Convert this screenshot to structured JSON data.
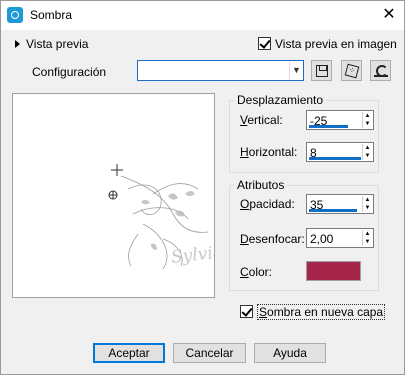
{
  "window": {
    "title": "Sombra",
    "app_icon": "paintshop-icon",
    "close_icon": "close-icon"
  },
  "preview": {
    "toggle_label": "Vista previa",
    "in_image_label": "Vista previa en imagen",
    "in_image_checked": true,
    "watermark_text": "Sylviane"
  },
  "configuration": {
    "label": "Configuración",
    "value": "",
    "buttons": [
      "save-preset-icon",
      "randomize-icon",
      "reset-icon"
    ]
  },
  "offset": {
    "title": "Desplazamiento",
    "vertical_label_key": "V",
    "vertical_label_rest": "ertical:",
    "vertical_value": "-25",
    "vertical_fill": 0.75,
    "horizontal_label_key": "H",
    "horizontal_label_rest": "orizontal:",
    "horizontal_value": "8",
    "horizontal_fill": 1.0
  },
  "attributes": {
    "title": "Atributos",
    "opacity_label_key": "O",
    "opacity_label_rest": "pacidad:",
    "opacity_value": "35",
    "opacity_fill": 0.92,
    "blur_label_key": "D",
    "blur_label_rest": "esenfocar:",
    "blur_value": "2,00",
    "color_label_key": "C",
    "color_label_rest": "olor:",
    "color_hex": "#a5254b"
  },
  "new_layer": {
    "label_key": "S",
    "label_rest": "ombra en nueva capa",
    "checked": true
  },
  "buttons": {
    "accept": "Aceptar",
    "cancel": "Cancelar",
    "help": "Ayuda"
  },
  "colors": {
    "accent": "#0f6fc6",
    "title_icon": "#1e9bd7"
  }
}
